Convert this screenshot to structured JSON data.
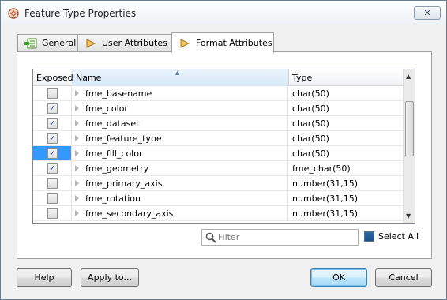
{
  "window": {
    "title": "Feature Type Properties",
    "close_label": "✕"
  },
  "tabs": [
    {
      "label": "General",
      "active": false
    },
    {
      "label": "User Attributes",
      "active": false
    },
    {
      "label": "Format Attributes",
      "active": true
    }
  ],
  "grid": {
    "columns": [
      "Exposed",
      "Name",
      "Type"
    ],
    "sort_indicator": "▲",
    "rows": [
      {
        "exposed": false,
        "name": "fme_basename",
        "type": "char(50)",
        "selected": false
      },
      {
        "exposed": true,
        "name": "fme_color",
        "type": "char(50)",
        "selected": false
      },
      {
        "exposed": true,
        "name": "fme_dataset",
        "type": "char(50)",
        "selected": false
      },
      {
        "exposed": true,
        "name": "fme_feature_type",
        "type": "char(50)",
        "selected": false
      },
      {
        "exposed": true,
        "name": "fme_fill_color",
        "type": "char(50)",
        "selected": true
      },
      {
        "exposed": true,
        "name": "fme_geometry",
        "type": "fme_char(50)",
        "selected": false
      },
      {
        "exposed": false,
        "name": "fme_primary_axis",
        "type": "number(31,15)",
        "selected": false
      },
      {
        "exposed": false,
        "name": "fme_rotation",
        "type": "number(31,15)",
        "selected": false
      },
      {
        "exposed": false,
        "name": "fme_secondary_axis",
        "type": "number(31,15)",
        "selected": false
      }
    ]
  },
  "filter": {
    "placeholder": "Filter",
    "value": ""
  },
  "select_all": {
    "label": "Select All",
    "checked": true
  },
  "buttons": {
    "help": "Help",
    "apply_to": "Apply to...",
    "ok": "OK",
    "cancel": "Cancel"
  },
  "colors": {
    "selection": "#3399ff",
    "accent": "#3c7fb1"
  }
}
